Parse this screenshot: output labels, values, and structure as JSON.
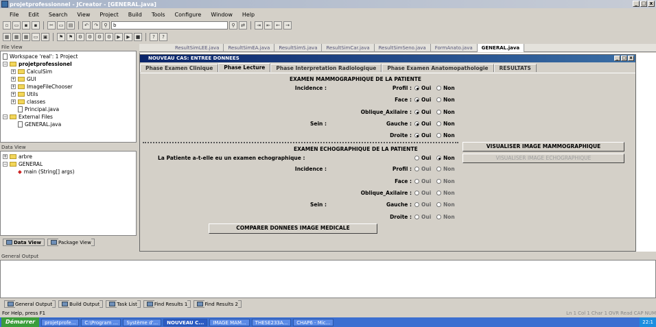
{
  "app": {
    "title": "projetprofessionnel - JCreator - [GENERAL.java]",
    "controls": [
      "_",
      "□",
      "x"
    ]
  },
  "menu": [
    "File",
    "Edit",
    "Search",
    "View",
    "Project",
    "Build",
    "Tools",
    "Configure",
    "Window",
    "Help"
  ],
  "toolbar": {
    "search_value": "b"
  },
  "file_view": {
    "header": "File View",
    "items": [
      {
        "label": "Workspace 'real': 1 Project",
        "type": "ws",
        "depth": 0
      },
      {
        "label": "projetprofessionel",
        "type": "proj",
        "depth": 0,
        "bold": true
      },
      {
        "label": "CalculSim",
        "type": "folder",
        "depth": 1
      },
      {
        "label": "GUI",
        "type": "folder",
        "depth": 1
      },
      {
        "label": "ImageFileChooser",
        "type": "folder",
        "depth": 1
      },
      {
        "label": "Utils",
        "type": "folder",
        "depth": 1
      },
      {
        "label": "classes",
        "type": "folder",
        "depth": 1
      },
      {
        "label": "Principal.java",
        "type": "file",
        "depth": 1
      },
      {
        "label": "External Files",
        "type": "folder",
        "depth": 0
      },
      {
        "label": "GENERAL.java",
        "type": "file",
        "depth": 1
      }
    ]
  },
  "data_view": {
    "header": "Data View",
    "items": [
      {
        "label": "arbre",
        "depth": 0
      },
      {
        "label": "GENERAL",
        "depth": 0
      },
      {
        "label": "main (String[] args)",
        "depth": 1
      }
    ],
    "tabs": [
      "Data View",
      "Package View"
    ]
  },
  "editor_tabs": [
    "ResultSimLEE.java",
    "ResultSimEA.java",
    "ResultSimS.java",
    "ResultSimCar.java",
    "ResultSimSeno.java",
    "FormAnato.java",
    "GENERAL.java"
  ],
  "dialog": {
    "title": "NOUVEAU CAS: ENTREE DONNEES",
    "tabs": [
      "Phase Examen Clinique",
      "Phase Lecture",
      "Phase Interpretation Radiologique",
      "Phase Examen Anatomopathologie",
      "RESULTATS"
    ],
    "active_tab": 1,
    "mammo": {
      "heading": "EXAMEN MAMMOGRAPHIQUE DE LA PATIENTE",
      "incidence_label": "Incidence :",
      "sein_label": "Sein :",
      "rows": [
        {
          "label": "Profil :",
          "checked": "Oui"
        },
        {
          "label": "Face :",
          "checked": "Oui"
        },
        {
          "label": "Oblique_Axilaire :",
          "checked": "Oui"
        },
        {
          "label": "Gauche :",
          "checked": "Oui"
        },
        {
          "label": "Droite :",
          "checked": "Oui"
        }
      ],
      "button": "VISUALISER IMAGE MAMMOGRAPHIQUE"
    },
    "echo": {
      "heading": "EXAMEN ECHOGRAPHIQUE DE LA PATIENTE",
      "question": "La Patiente a-t-elle eu un examen echographique :",
      "question_checked": "Non",
      "incidence_label": "Incidence :",
      "sein_label": "Sein :",
      "rows": [
        {
          "label": "Profil :",
          "checked": ""
        },
        {
          "label": "Face :",
          "checked": ""
        },
        {
          "label": "Oblique_Axilaire :",
          "checked": ""
        },
        {
          "label": "Gauche :",
          "checked": ""
        },
        {
          "label": "Droite :",
          "checked": ""
        }
      ],
      "button": "VISUALISER IMAGE ECHOGRAPHIQUE"
    },
    "oui": "Oui",
    "non": "Non",
    "compare_button": "COMPARER DONNEES IMAGE MEDICALE"
  },
  "output": {
    "header": "General Output",
    "tabs": [
      "General Output",
      "Build Output",
      "Task List",
      "Find Results 1",
      "Find Results 2"
    ]
  },
  "status": {
    "text": "For Help, press F1",
    "right": [
      "Ln 1",
      "Col 1",
      "Char 1",
      "OVR",
      "Read",
      "CAP",
      "NUM"
    ]
  },
  "taskbar": {
    "start": "Démarrer",
    "tasks": [
      "projetprofe...",
      "C:\\Program ...",
      "Système d'...",
      "NOUVEAU C...",
      "IMAGE MAM...",
      "THESE233A...",
      "CHAP6 - Mic..."
    ],
    "active": 3,
    "clock": "22:1"
  }
}
